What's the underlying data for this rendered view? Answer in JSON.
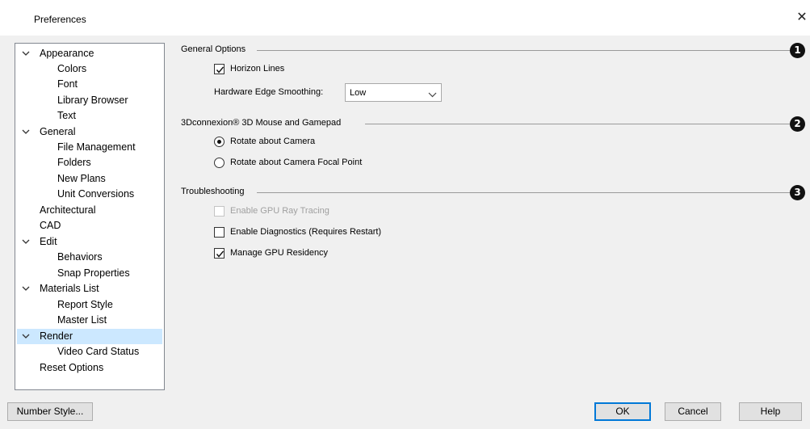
{
  "window": {
    "title": "Preferences",
    "close_icon": "close-icon"
  },
  "tree": {
    "items": [
      {
        "label": "Appearance",
        "expanded": true
      },
      {
        "label": "Colors"
      },
      {
        "label": "Font"
      },
      {
        "label": "Library Browser"
      },
      {
        "label": "Text"
      },
      {
        "label": "General",
        "expanded": true
      },
      {
        "label": "File Management"
      },
      {
        "label": "Folders"
      },
      {
        "label": "New Plans"
      },
      {
        "label": "Unit Conversions"
      },
      {
        "label": "Architectural"
      },
      {
        "label": "CAD"
      },
      {
        "label": "Edit",
        "expanded": true
      },
      {
        "label": "Behaviors"
      },
      {
        "label": "Snap Properties"
      },
      {
        "label": "Materials List",
        "expanded": true
      },
      {
        "label": "Report Style"
      },
      {
        "label": "Master List"
      },
      {
        "label": "Render",
        "expanded": true,
        "selected": true
      },
      {
        "label": "Video Card Status"
      },
      {
        "label": "Reset Options"
      }
    ]
  },
  "sections": {
    "general_options": {
      "title": "General Options",
      "badge": "1",
      "horizon_lines": {
        "label": "Horizon Lines",
        "checked": true
      },
      "edge_smoothing": {
        "label": "Hardware Edge Smoothing:",
        "value": "Low"
      }
    },
    "mouse": {
      "title": "3Dconnexion® 3D Mouse and Gamepad",
      "badge": "2",
      "rotate_camera": {
        "label": "Rotate about Camera",
        "selected": true
      },
      "rotate_focal": {
        "label": "Rotate about Camera Focal Point",
        "selected": false
      }
    },
    "troubleshooting": {
      "title": "Troubleshooting",
      "badge": "3",
      "gpu_ray_tracing": {
        "label": "Enable GPU Ray Tracing",
        "checked": false,
        "enabled": false
      },
      "diagnostics": {
        "label": "Enable Diagnostics (Requires Restart)",
        "checked": false
      },
      "gpu_residency": {
        "label": "Manage GPU Residency",
        "checked": true
      }
    }
  },
  "buttons": {
    "number_style": "Number Style...",
    "ok": "OK",
    "cancel": "Cancel",
    "help": "Help"
  },
  "colors": {
    "selection": "#cce8ff",
    "default_button_border": "#0078d7",
    "dialog_background": "#f0f0f0"
  }
}
